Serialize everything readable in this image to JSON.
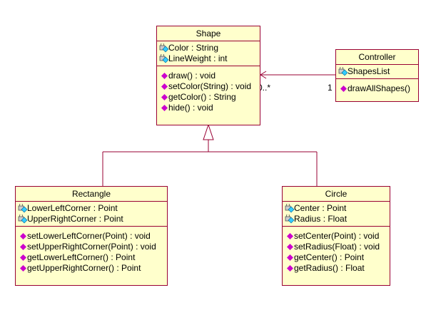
{
  "classes": {
    "shape": {
      "name": "Shape",
      "attributes": [
        "Color : String",
        "LineWeight : int"
      ],
      "operations": [
        "draw() : void",
        "setColor(String) : void",
        "getColor() : String",
        "hide() : void"
      ]
    },
    "controller": {
      "name": "Controller",
      "attributes": [
        "ShapesList"
      ],
      "operations": [
        "drawAllShapes()"
      ]
    },
    "rectangle": {
      "name": "Rectangle",
      "attributes": [
        "LowerLeftCorner : Point",
        "UpperRightCorner : Point"
      ],
      "operations": [
        "setLowerLeftCorner(Point) : void",
        "setUpperRightCorner(Point) : void",
        "getLowerLeftCorner() : Point",
        "getUpperRightCorner() : Point"
      ]
    },
    "circle": {
      "name": "Circle",
      "attributes": [
        "Center : Point",
        "Radius : Float"
      ],
      "operations": [
        "setCenter(Point) : void",
        "setRadius(Float) : void",
        "getCenter() : Point",
        "getRadius() : Float"
      ]
    }
  },
  "association": {
    "source_multiplicity": "1",
    "target_multiplicity": "0..*"
  },
  "colors": {
    "class_fill": "#ffffcc",
    "class_border": "#990033",
    "operation_icon": "#cc00cc",
    "attribute_icon": "#33ccff"
  }
}
